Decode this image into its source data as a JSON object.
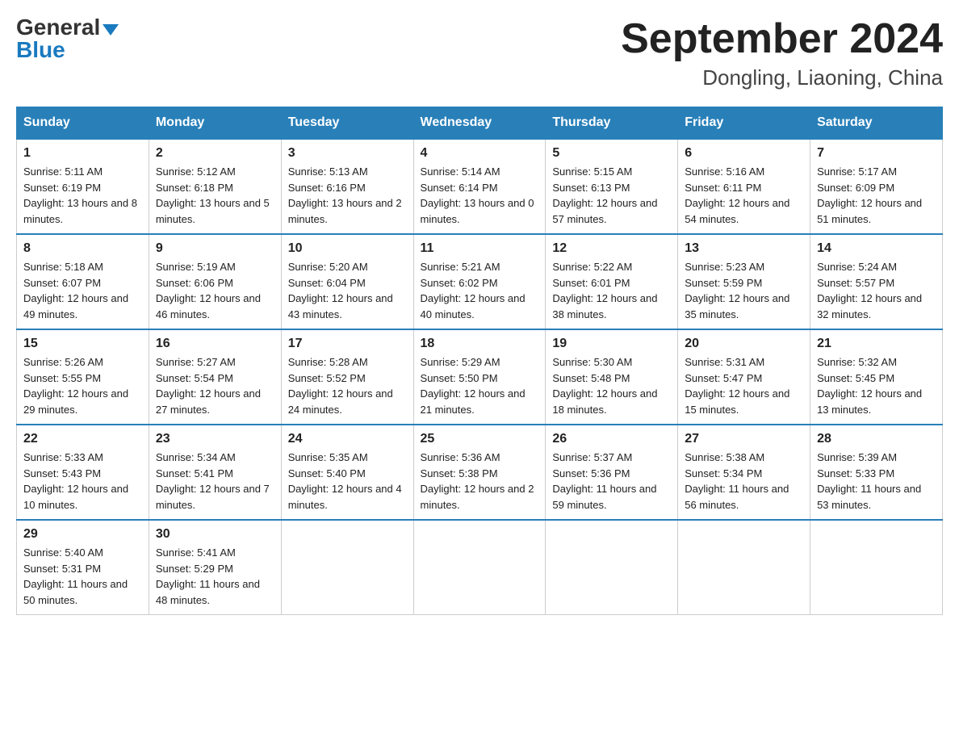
{
  "header": {
    "logo_general": "General",
    "logo_blue": "Blue",
    "month_title": "September 2024",
    "location": "Dongling, Liaoning, China"
  },
  "columns": [
    "Sunday",
    "Monday",
    "Tuesday",
    "Wednesday",
    "Thursday",
    "Friday",
    "Saturday"
  ],
  "weeks": [
    [
      {
        "day": "1",
        "sunrise": "5:11 AM",
        "sunset": "6:19 PM",
        "daylight": "13 hours and 8 minutes."
      },
      {
        "day": "2",
        "sunrise": "5:12 AM",
        "sunset": "6:18 PM",
        "daylight": "13 hours and 5 minutes."
      },
      {
        "day": "3",
        "sunrise": "5:13 AM",
        "sunset": "6:16 PM",
        "daylight": "13 hours and 2 minutes."
      },
      {
        "day": "4",
        "sunrise": "5:14 AM",
        "sunset": "6:14 PM",
        "daylight": "13 hours and 0 minutes."
      },
      {
        "day": "5",
        "sunrise": "5:15 AM",
        "sunset": "6:13 PM",
        "daylight": "12 hours and 57 minutes."
      },
      {
        "day": "6",
        "sunrise": "5:16 AM",
        "sunset": "6:11 PM",
        "daylight": "12 hours and 54 minutes."
      },
      {
        "day": "7",
        "sunrise": "5:17 AM",
        "sunset": "6:09 PM",
        "daylight": "12 hours and 51 minutes."
      }
    ],
    [
      {
        "day": "8",
        "sunrise": "5:18 AM",
        "sunset": "6:07 PM",
        "daylight": "12 hours and 49 minutes."
      },
      {
        "day": "9",
        "sunrise": "5:19 AM",
        "sunset": "6:06 PM",
        "daylight": "12 hours and 46 minutes."
      },
      {
        "day": "10",
        "sunrise": "5:20 AM",
        "sunset": "6:04 PM",
        "daylight": "12 hours and 43 minutes."
      },
      {
        "day": "11",
        "sunrise": "5:21 AM",
        "sunset": "6:02 PM",
        "daylight": "12 hours and 40 minutes."
      },
      {
        "day": "12",
        "sunrise": "5:22 AM",
        "sunset": "6:01 PM",
        "daylight": "12 hours and 38 minutes."
      },
      {
        "day": "13",
        "sunrise": "5:23 AM",
        "sunset": "5:59 PM",
        "daylight": "12 hours and 35 minutes."
      },
      {
        "day": "14",
        "sunrise": "5:24 AM",
        "sunset": "5:57 PM",
        "daylight": "12 hours and 32 minutes."
      }
    ],
    [
      {
        "day": "15",
        "sunrise": "5:26 AM",
        "sunset": "5:55 PM",
        "daylight": "12 hours and 29 minutes."
      },
      {
        "day": "16",
        "sunrise": "5:27 AM",
        "sunset": "5:54 PM",
        "daylight": "12 hours and 27 minutes."
      },
      {
        "day": "17",
        "sunrise": "5:28 AM",
        "sunset": "5:52 PM",
        "daylight": "12 hours and 24 minutes."
      },
      {
        "day": "18",
        "sunrise": "5:29 AM",
        "sunset": "5:50 PM",
        "daylight": "12 hours and 21 minutes."
      },
      {
        "day": "19",
        "sunrise": "5:30 AM",
        "sunset": "5:48 PM",
        "daylight": "12 hours and 18 minutes."
      },
      {
        "day": "20",
        "sunrise": "5:31 AM",
        "sunset": "5:47 PM",
        "daylight": "12 hours and 15 minutes."
      },
      {
        "day": "21",
        "sunrise": "5:32 AM",
        "sunset": "5:45 PM",
        "daylight": "12 hours and 13 minutes."
      }
    ],
    [
      {
        "day": "22",
        "sunrise": "5:33 AM",
        "sunset": "5:43 PM",
        "daylight": "12 hours and 10 minutes."
      },
      {
        "day": "23",
        "sunrise": "5:34 AM",
        "sunset": "5:41 PM",
        "daylight": "12 hours and 7 minutes."
      },
      {
        "day": "24",
        "sunrise": "5:35 AM",
        "sunset": "5:40 PM",
        "daylight": "12 hours and 4 minutes."
      },
      {
        "day": "25",
        "sunrise": "5:36 AM",
        "sunset": "5:38 PM",
        "daylight": "12 hours and 2 minutes."
      },
      {
        "day": "26",
        "sunrise": "5:37 AM",
        "sunset": "5:36 PM",
        "daylight": "11 hours and 59 minutes."
      },
      {
        "day": "27",
        "sunrise": "5:38 AM",
        "sunset": "5:34 PM",
        "daylight": "11 hours and 56 minutes."
      },
      {
        "day": "28",
        "sunrise": "5:39 AM",
        "sunset": "5:33 PM",
        "daylight": "11 hours and 53 minutes."
      }
    ],
    [
      {
        "day": "29",
        "sunrise": "5:40 AM",
        "sunset": "5:31 PM",
        "daylight": "11 hours and 50 minutes."
      },
      {
        "day": "30",
        "sunrise": "5:41 AM",
        "sunset": "5:29 PM",
        "daylight": "11 hours and 48 minutes."
      },
      null,
      null,
      null,
      null,
      null
    ]
  ]
}
